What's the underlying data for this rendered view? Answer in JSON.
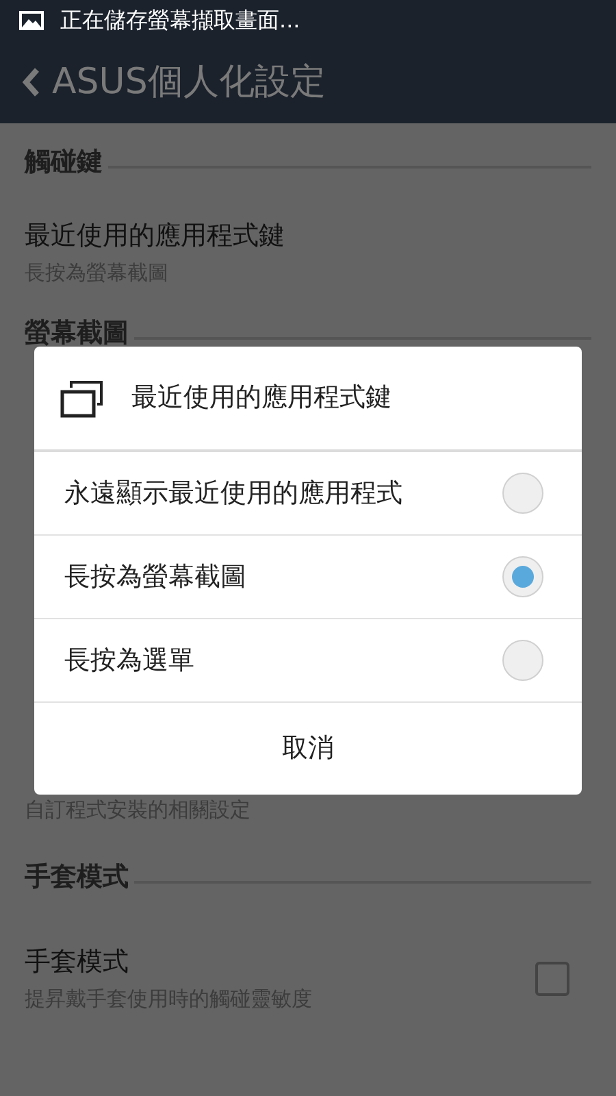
{
  "status_bar": {
    "text": "正在儲存螢幕擷取畫面..."
  },
  "app_bar": {
    "title": "ASUS個人化設定"
  },
  "list": [
    {
      "kind": "header",
      "text": "觸碰鍵"
    },
    {
      "kind": "item",
      "title": "最近使用的應用程式鍵",
      "summary": "長按為螢幕截圖"
    },
    {
      "kind": "header",
      "text": "螢幕截圖"
    },
    {
      "kind": "summary",
      "text": "自訂程式安裝的相關設定"
    },
    {
      "kind": "header",
      "text": "手套模式"
    },
    {
      "kind": "checkbox",
      "title": "手套模式",
      "summary": "提昇戴手套使用時的觸碰靈敏度",
      "checked": false
    }
  ],
  "dialog": {
    "title": "最近使用的應用程式鍵",
    "options": [
      {
        "label": "永遠顯示最近使用的應用程式",
        "selected": false
      },
      {
        "label": "長按為螢幕截圖",
        "selected": true
      },
      {
        "label": "長按為選單",
        "selected": false
      }
    ],
    "cancel": "取消"
  }
}
